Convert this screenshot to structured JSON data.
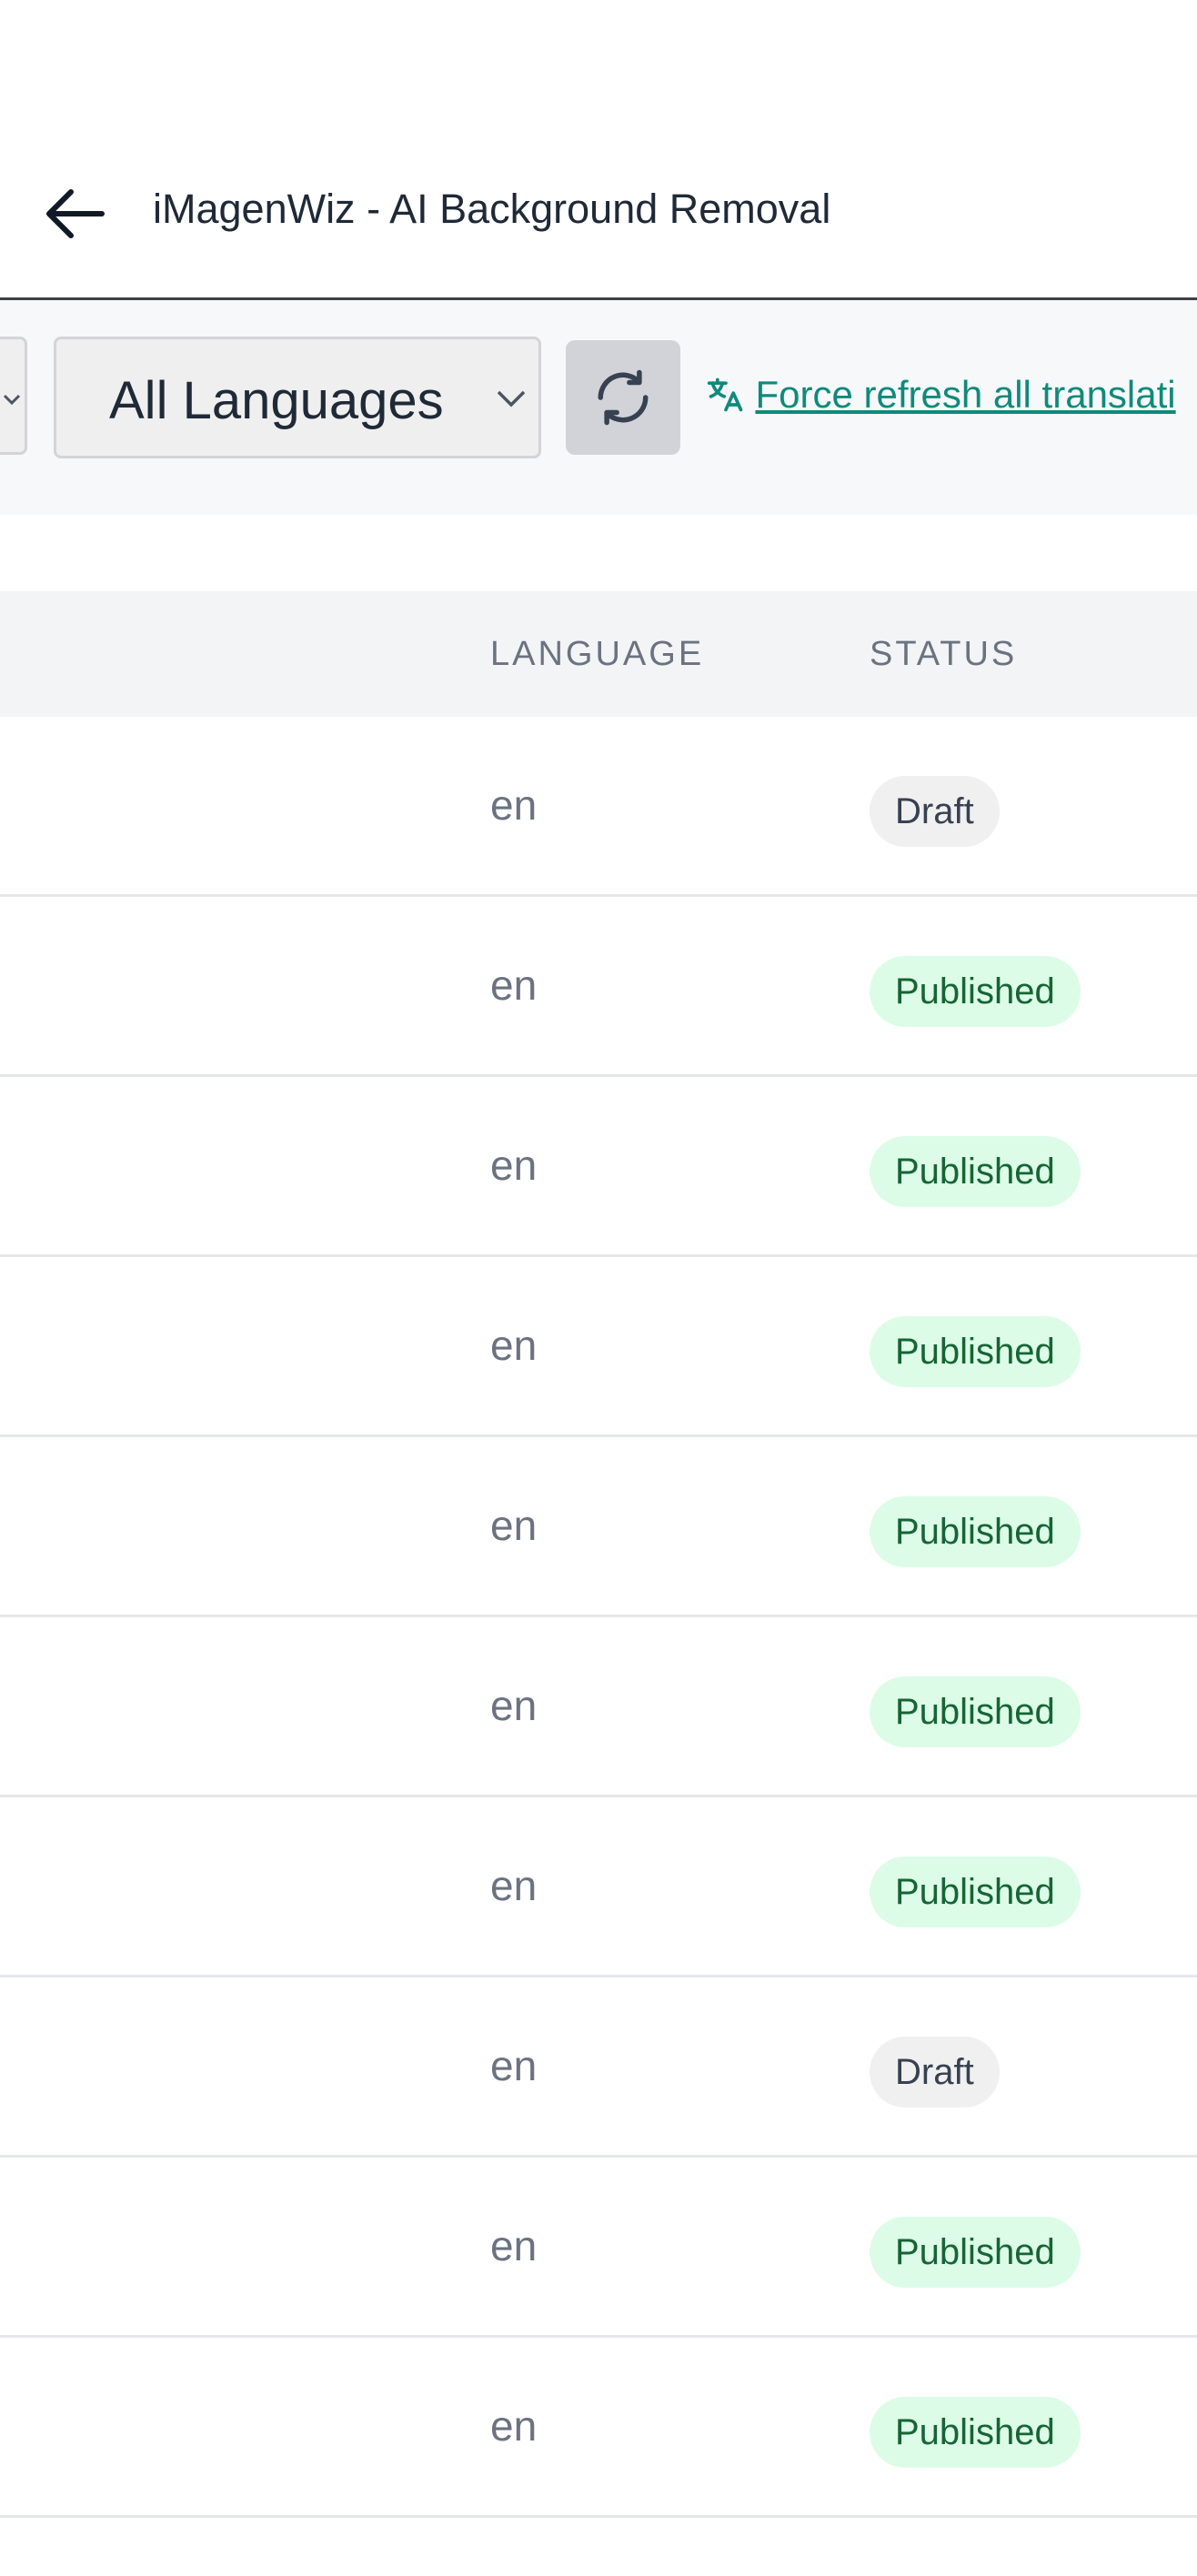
{
  "header": {
    "title": "iMagenWiz - AI Background Removal",
    "back_icon": "arrow-left-icon"
  },
  "toolbar": {
    "language_filter": {
      "selected": "All Languages",
      "icon": "chevron-down-icon"
    },
    "refresh_button": {
      "icon": "refresh-icon"
    },
    "force_refresh_link": {
      "label": "Force refresh all translati",
      "icon": "translate-icon"
    }
  },
  "table": {
    "columns": [
      "LANGUAGE",
      "STATUS"
    ],
    "rows": [
      {
        "language": "en",
        "status": "Draft"
      },
      {
        "language": "en",
        "status": "Published"
      },
      {
        "language": "en",
        "status": "Published"
      },
      {
        "language": "en",
        "status": "Published"
      },
      {
        "language": "en",
        "status": "Published"
      },
      {
        "language": "en",
        "status": "Published"
      },
      {
        "language": "en",
        "status": "Published"
      },
      {
        "language": "en",
        "status": "Draft"
      },
      {
        "language": "en",
        "status": "Published"
      },
      {
        "language": "en",
        "status": "Published"
      }
    ]
  },
  "colors": {
    "link": "#0f8a7a",
    "published_bg": "#dcfce7",
    "published_text": "#166534",
    "draft_bg": "#f0f0f0",
    "header_bg": "#f3f4f6"
  }
}
